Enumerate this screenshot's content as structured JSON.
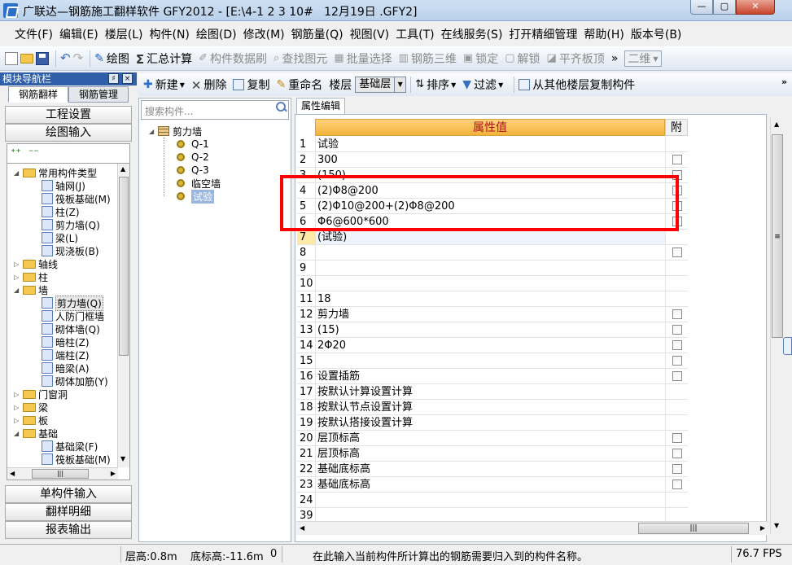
{
  "window": {
    "title": "广联达—钢筋施工翻样软件 GFY2012 - [E:\\4-1 2 3 10#   12月19日 .GFY2]",
    "min_label": "—",
    "max_label": "▢",
    "close_label": "✕"
  },
  "menu": {
    "items": [
      "文件(F)",
      "编辑(E)",
      "楼层(L)",
      "构件(N)",
      "绘图(D)",
      "修改(M)",
      "钢筋量(Q)",
      "视图(V)",
      "工具(T)",
      "在线服务(S)",
      "打开精细管理",
      "帮助(H)",
      "版本号(B)"
    ]
  },
  "toolbar_main": {
    "draw": "绘图",
    "calc": "汇总计算",
    "component_brush": "构件数据刷",
    "find_element": "查找图元",
    "batch_select": "批量选择",
    "rebar_3d": "钢筋三维",
    "lock": "锁定",
    "unlock": "解锁",
    "align_slab": "平齐板顶",
    "more": "»",
    "view_2d": "二维"
  },
  "toolbar_component": {
    "new": "新建",
    "delete": "删除",
    "copy": "复制",
    "rename": "重命名",
    "floor_label": "楼层",
    "floor_value": "基础层",
    "sort": "排序",
    "filter": "过滤",
    "copy_from_floor": "从其他楼层复制构件",
    "more": "»"
  },
  "nav": {
    "header": "模块导航栏",
    "pin": "♯",
    "close": "×",
    "tabs": [
      "钢筋翻样",
      "钢筋管理"
    ],
    "sections": {
      "project_settings": "工程设置",
      "drawing_input": "绘图输入",
      "single_input": "单构件输入",
      "detail": "翻样明细",
      "report": "报表输出"
    },
    "tree": [
      {
        "label": "常用构件类型",
        "level": 0,
        "kind": "folder",
        "expanded": true
      },
      {
        "label": "轴网(J)",
        "level": 1,
        "kind": "grid-icon"
      },
      {
        "label": "筏板基础(M)",
        "level": 1,
        "kind": "raft-icon"
      },
      {
        "label": "柱(Z)",
        "level": 1,
        "kind": "column-icon"
      },
      {
        "label": "剪力墙(Q)",
        "level": 1,
        "kind": "shear-wall-icon"
      },
      {
        "label": "梁(L)",
        "level": 1,
        "kind": "beam-icon"
      },
      {
        "label": "现浇板(B)",
        "level": 1,
        "kind": "slab-icon"
      },
      {
        "label": "轴线",
        "level": 0,
        "kind": "folder",
        "expanded": false
      },
      {
        "label": "柱",
        "level": 0,
        "kind": "folder",
        "expanded": false
      },
      {
        "label": "墙",
        "level": 0,
        "kind": "folder",
        "expanded": true
      },
      {
        "label": "剪力墙(Q)",
        "level": 1,
        "kind": "shear-wall-icon",
        "selected": true
      },
      {
        "label": "人防门框墙",
        "level": 1,
        "kind": "door-frame-wall-icon"
      },
      {
        "label": "砌体墙(Q)",
        "level": 1,
        "kind": "masonry-wall-icon"
      },
      {
        "label": "暗柱(Z)",
        "level": 1,
        "kind": "hidden-column-icon"
      },
      {
        "label": "端柱(Z)",
        "level": 1,
        "kind": "end-column-icon"
      },
      {
        "label": "暗梁(A)",
        "level": 1,
        "kind": "hidden-beam-icon"
      },
      {
        "label": "砌体加筋(Y)",
        "level": 1,
        "kind": "masonry-rebar-icon"
      },
      {
        "label": "门窗洞",
        "level": 0,
        "kind": "folder",
        "expanded": false
      },
      {
        "label": "梁",
        "level": 0,
        "kind": "folder",
        "expanded": false
      },
      {
        "label": "板",
        "level": 0,
        "kind": "folder",
        "expanded": false
      },
      {
        "label": "基础",
        "level": 0,
        "kind": "folder",
        "expanded": true
      },
      {
        "label": "基础梁(F)",
        "level": 1,
        "kind": "foundation-beam-icon"
      },
      {
        "label": "筏板基础(M)",
        "level": 1,
        "kind": "raft-icon"
      }
    ]
  },
  "component_list": {
    "search_placeholder": "搜索构件...",
    "root": "剪力墙",
    "items": [
      "Q-1",
      "Q-2",
      "Q-3",
      "临空墙",
      "试验"
    ],
    "selected": "试验"
  },
  "property_grid": {
    "tab": "属性编辑",
    "col_value": "属性值",
    "col_attach": "附",
    "rows": [
      {
        "n": "1",
        "v": "试验",
        "cb": false
      },
      {
        "n": "2",
        "v": "300",
        "cb": true
      },
      {
        "n": "3",
        "v": "(150)",
        "cb": true
      },
      {
        "n": "4",
        "v": "(2)Φ8@200",
        "cb": true
      },
      {
        "n": "5",
        "v": "(2)Φ10@200+(2)Φ8@200",
        "cb": true
      },
      {
        "n": "6",
        "v": "Φ6@600*600",
        "cb": true
      },
      {
        "n": "7",
        "v": "(试验)",
        "cb": false
      },
      {
        "n": "8",
        "v": "",
        "cb": true
      },
      {
        "n": "9",
        "v": "",
        "cb": false
      },
      {
        "n": "10",
        "v": "",
        "cb": false
      },
      {
        "n": "11",
        "v": "18",
        "cb": false
      },
      {
        "n": "12",
        "v": "剪力墙",
        "cb": true
      },
      {
        "n": "13",
        "v": "(15)",
        "cb": true
      },
      {
        "n": "14",
        "v": "2Φ20",
        "cb": true
      },
      {
        "n": "15",
        "v": "",
        "cb": true
      },
      {
        "n": "16",
        "v": "设置插筋",
        "cb": true
      },
      {
        "n": "17",
        "v": "按默认计算设置计算",
        "cb": false
      },
      {
        "n": "18",
        "v": "按默认节点设置计算",
        "cb": false
      },
      {
        "n": "19",
        "v": "按默认搭接设置计算",
        "cb": false
      },
      {
        "n": "20",
        "v": "层顶标高",
        "cb": true
      },
      {
        "n": "21",
        "v": "层顶标高",
        "cb": true
      },
      {
        "n": "22",
        "v": "基础底标高",
        "cb": true
      },
      {
        "n": "23",
        "v": "基础底标高",
        "cb": true
      },
      {
        "n": "24",
        "v": "",
        "cb": false
      },
      {
        "n": "39",
        "v": "",
        "cb": false
      }
    ],
    "active_row": "7"
  },
  "status": {
    "floor_height": "层高:0.8m",
    "base_elevation": "底标高:-11.6m",
    "extra": "0",
    "hint": "在此输入当前构件所计算出的钢筋需要归入到的构件名称。",
    "fps": "76.7 FPS"
  },
  "colors": {
    "accent": "#2f5fa8",
    "highlight_box": "#ff0000",
    "header_value": "#f3b33b",
    "header_value_text": "#b0141c"
  }
}
